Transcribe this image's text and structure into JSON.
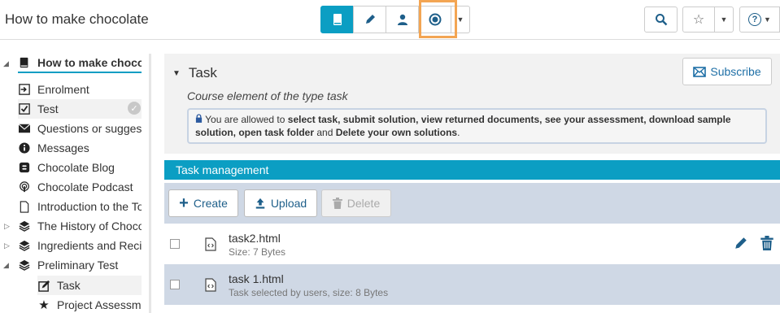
{
  "topbar": {
    "course_title": "How to make chocolate",
    "tools": [
      "book-icon",
      "pencil-icon",
      "user-icon",
      "assessment-icon",
      "caret-down-icon"
    ],
    "right_tools": [
      "search-icon",
      "star-icon",
      "caret-down-icon",
      "help-icon",
      "caret-down-icon"
    ],
    "help_label": "?"
  },
  "sidebar": {
    "items": [
      {
        "label": "How to make chocolate",
        "icon": "book-icon"
      },
      {
        "label": "Enrolment",
        "icon": "enrolment-icon"
      },
      {
        "label": "Test",
        "icon": "test-icon"
      },
      {
        "label": "Questions or suggestions",
        "icon": "envelope-icon"
      },
      {
        "label": "Messages",
        "icon": "info-icon"
      },
      {
        "label": "Chocolate Blog",
        "icon": "blog-icon"
      },
      {
        "label": "Chocolate Podcast",
        "icon": "podcast-icon"
      },
      {
        "label": "Introduction to the Topic",
        "icon": "page-icon"
      },
      {
        "label": "The History of Chocolate",
        "icon": "layers-icon"
      },
      {
        "label": "Ingredients and Recipes",
        "icon": "layers-icon"
      },
      {
        "label": "Preliminary Test",
        "icon": "layers-icon"
      },
      {
        "label": "Task",
        "icon": "task-icon"
      },
      {
        "label": "Project Assessment",
        "icon": "star-icon"
      }
    ]
  },
  "main": {
    "title": "Task",
    "subscribe_label": "Subscribe",
    "description": "Course element of the type task",
    "info": {
      "prefix": "You are allowed to ",
      "bold1": "select task, submit solution, view returned documents, see your assessment, download sample solution, open task folder",
      "middle": " and ",
      "bold2": "Delete your own solutions",
      "suffix": "."
    },
    "management_title": "Task management",
    "buttons": {
      "create": "Create",
      "upload": "Upload",
      "delete": "Delete"
    },
    "files": [
      {
        "name": "task2.html",
        "meta": "Size: 7 Bytes"
      },
      {
        "name": "task 1.html",
        "meta": "Task selected by users, size: 8 Bytes"
      }
    ]
  },
  "colors": {
    "accent": "#0b9ec3",
    "highlight": "#f3a553",
    "row_alt": "#cfd8e5"
  }
}
